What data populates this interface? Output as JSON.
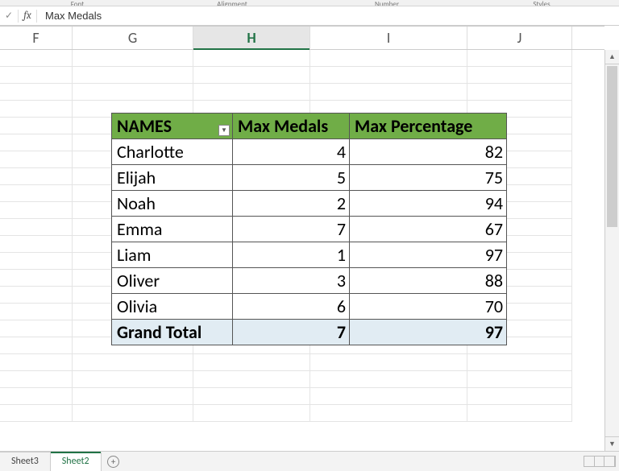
{
  "ribbon_groups": [
    "Font",
    "Alignment",
    "Number",
    "Styles"
  ],
  "formula_bar": {
    "value": "Max Medals"
  },
  "columns": [
    "F",
    "G",
    "H",
    "I",
    "J"
  ],
  "selected_col": "H",
  "pivot": {
    "headers": {
      "names": "NAMES",
      "medals": "Max Medals",
      "pct": "Max Percentage"
    },
    "rows": [
      {
        "name": "Charlotte",
        "medals": 4,
        "pct": 82
      },
      {
        "name": "Elijah",
        "medals": 5,
        "pct": 75
      },
      {
        "name": "Noah",
        "medals": 2,
        "pct": 94
      },
      {
        "name": "Emma",
        "medals": 7,
        "pct": 67
      },
      {
        "name": "Liam",
        "medals": 1,
        "pct": 97
      },
      {
        "name": "Oliver",
        "medals": 3,
        "pct": 88
      },
      {
        "name": "Olivia",
        "medals": 6,
        "pct": 70
      }
    ],
    "grand": {
      "label": "Grand Total",
      "medals": 7,
      "pct": 97
    }
  },
  "tabs": {
    "items": [
      "Sheet3",
      "Sheet2"
    ],
    "active": "Sheet2"
  }
}
